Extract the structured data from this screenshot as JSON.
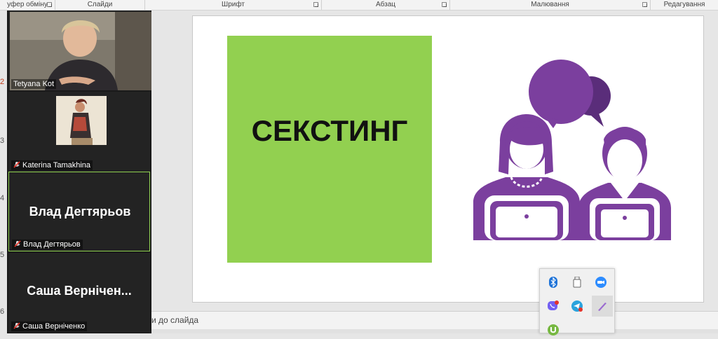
{
  "ribbon": {
    "groups": [
      "уфер обміну",
      "Слайди",
      "Шрифт",
      "Абзац",
      "Малювання",
      "Редагування"
    ]
  },
  "slide_numbers": [
    "2",
    "3",
    "4",
    "5",
    "6"
  ],
  "slide": {
    "title": "СЕКСТИНГ",
    "colors": {
      "green": "#92d050",
      "purple": "#7b3f9e"
    }
  },
  "notes": {
    "placeholder": "и до слайда"
  },
  "participants": [
    {
      "name": "Tetyana Kot",
      "muted": false,
      "display": ""
    },
    {
      "name": "Katerina Tamakhina",
      "muted": true,
      "display": ""
    },
    {
      "name": "Влад Дегтярьов",
      "muted": true,
      "display": "Влад Дегтярьов"
    },
    {
      "name": "Саша Верніченко",
      "muted": true,
      "display": "Саша  Вернічен..."
    }
  ],
  "tray": {
    "icons": [
      "bluetooth-icon",
      "usb-drive-icon",
      "zoom-icon",
      "viber-icon",
      "telegram-icon",
      "pen-icon",
      "utorrent-icon"
    ]
  }
}
